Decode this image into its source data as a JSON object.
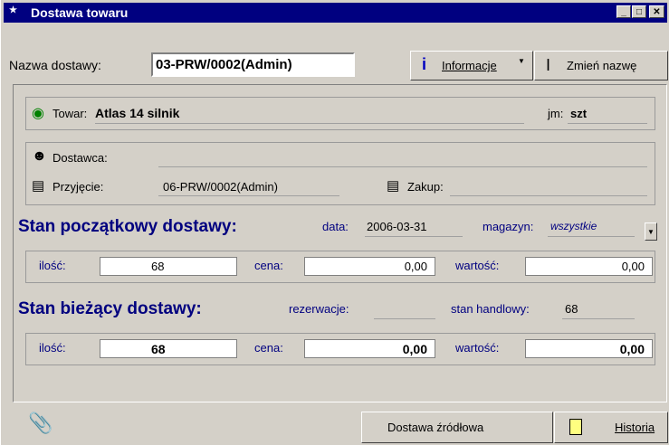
{
  "window": {
    "title": "Dostawa towaru"
  },
  "header": {
    "name_label": "Nazwa dostawy:",
    "name_value": "03-PRW/0002(Admin)",
    "info_button": "Informacje",
    "rename_button": "Zmień nazwę"
  },
  "towar": {
    "label": "Towar:",
    "value": "Atlas 14 silnik",
    "unit_label": "jm:",
    "unit_value": "szt"
  },
  "supplier": {
    "dostawca_label": "Dostawca:",
    "dostawca_value": "",
    "przyjecie_label": "Przyjęcie:",
    "przyjecie_value": "06-PRW/0002(Admin)",
    "zakup_label": "Zakup:",
    "zakup_value": ""
  },
  "initial": {
    "heading": "Stan początkowy dostawy:",
    "date_label": "data:",
    "date_value": "2006-03-31",
    "warehouse_label": "magazyn:",
    "warehouse_value": "wszystkie",
    "qty_label": "ilość:",
    "qty_value": "68",
    "price_label": "cena:",
    "price_value": "0,00",
    "value_label": "wartość:",
    "value_value": "0,00"
  },
  "current": {
    "heading": "Stan bieżący dostawy:",
    "reservation_label": "rezerwacje:",
    "reservation_value": "",
    "trade_label": "stan handlowy:",
    "trade_value": "68",
    "qty_label": "ilość:",
    "qty_value": "68",
    "price_label": "cena:",
    "price_value": "0,00",
    "value_label": "wartość:",
    "value_value": "0,00"
  },
  "footer": {
    "source_button": "Dostawa źródłowa",
    "history_button": "Historia"
  }
}
